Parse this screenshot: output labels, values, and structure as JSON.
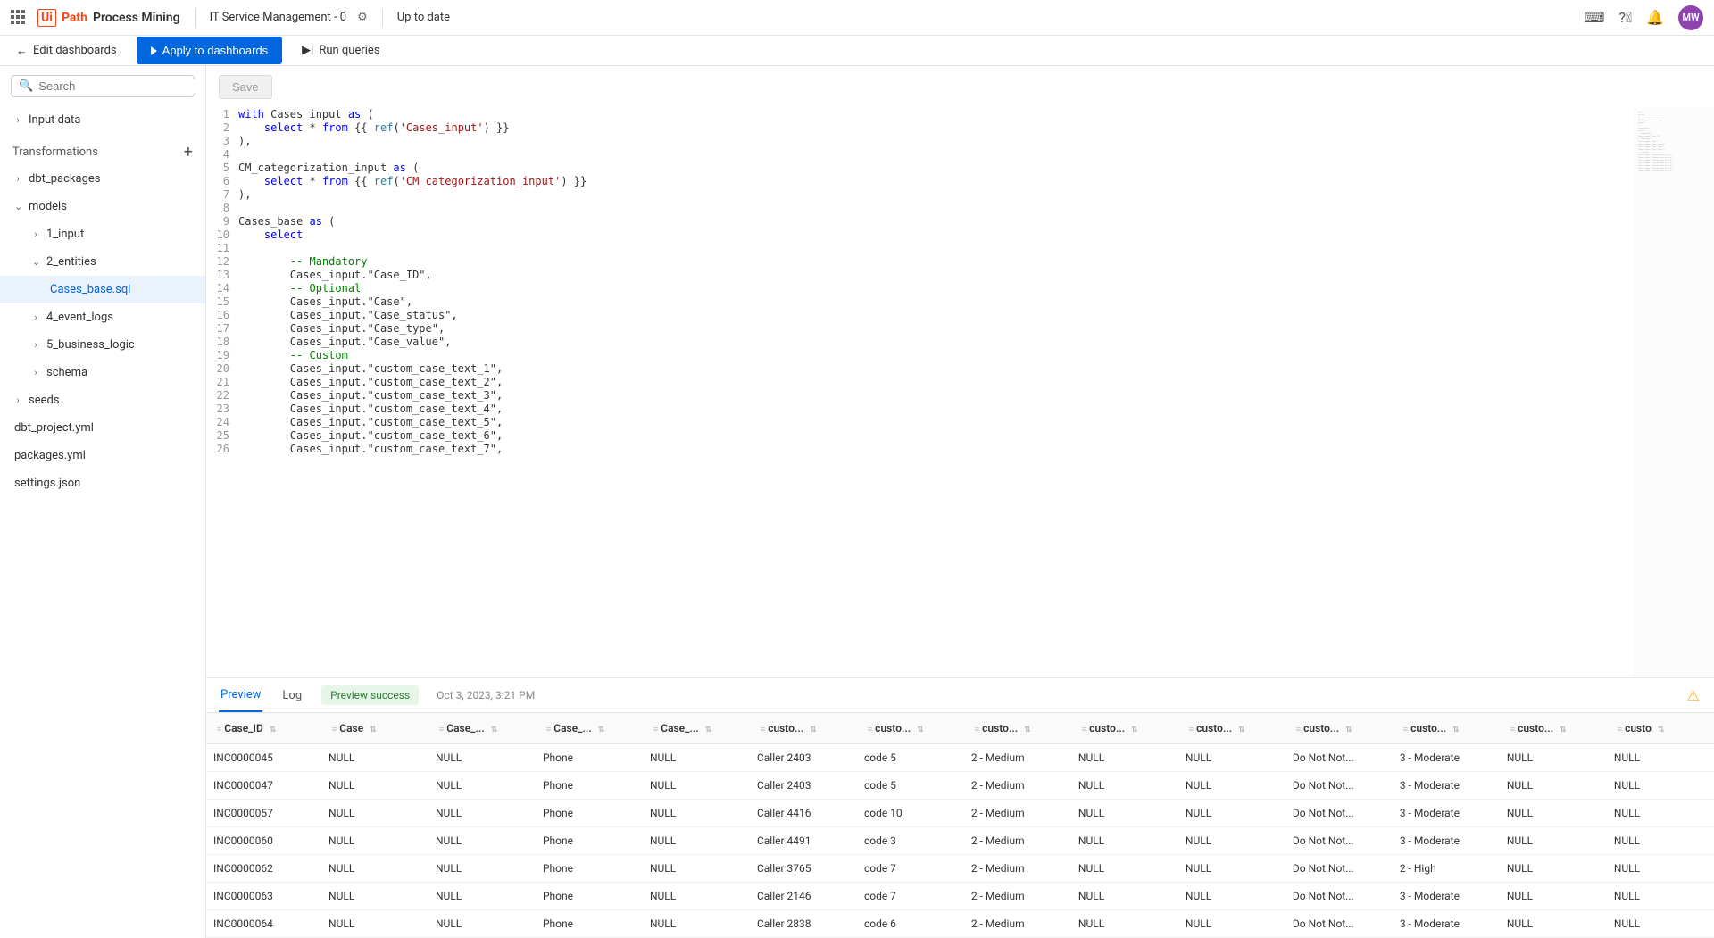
{
  "header": {
    "logo_brand": "Ui",
    "logo_path": "Path",
    "product": "Process Mining",
    "project": "IT Service Management - 0",
    "status": "Up to date",
    "avatar": "MW"
  },
  "toolbar": {
    "edit": "Edit dashboards",
    "apply": "Apply to dashboards",
    "run": "Run queries"
  },
  "sidebar": {
    "search_ph": "Search",
    "input_data": "Input data",
    "transformations": "Transformations",
    "tree": {
      "dbt_packages": "dbt_packages",
      "models": "models",
      "input1": "1_input",
      "entities2": "2_entities",
      "cases_base": "Cases_base.sql",
      "event_logs4": "4_event_logs",
      "business_logic5": "5_business_logic",
      "schema": "schema",
      "seeds": "seeds",
      "dbt_project": "dbt_project.yml",
      "packages": "packages.yml",
      "settings": "settings.json"
    }
  },
  "editor": {
    "save": "Save",
    "lines": [
      {
        "n": 1,
        "t": "with",
        "r": " Cases_input ",
        "t2": "as",
        "r2": " ("
      },
      {
        "n": 2,
        "indent": "    ",
        "t": "select",
        "r": " * ",
        "t2": "from",
        "r2": " {{ ",
        "fn": "ref",
        "r3": "(",
        "s": "'Cases_input'",
        "r4": ") }}"
      },
      {
        "n": 3,
        "plain": "),"
      },
      {
        "n": 4,
        "plain": ""
      },
      {
        "n": 5,
        "plain": "CM_categorization_input ",
        "t": "as",
        "r": " ("
      },
      {
        "n": 6,
        "indent": "    ",
        "t": "select",
        "r": " * ",
        "t2": "from",
        "r2": " {{ ",
        "fn": "ref",
        "r3": "(",
        "s": "'CM_categorization_input'",
        "r4": ") }}"
      },
      {
        "n": 7,
        "plain": "),"
      },
      {
        "n": 8,
        "plain": ""
      },
      {
        "n": 9,
        "plain": "Cases_base ",
        "t": "as",
        "r": " ("
      },
      {
        "n": 10,
        "indent": "    ",
        "t": "select"
      },
      {
        "n": 11,
        "plain": ""
      },
      {
        "n": 12,
        "indent": "        ",
        "c": "-- Mandatory"
      },
      {
        "n": 13,
        "indent": "        ",
        "plain": "Cases_input.\"Case_ID\","
      },
      {
        "n": 14,
        "indent": "        ",
        "c": "-- Optional"
      },
      {
        "n": 15,
        "indent": "        ",
        "plain": "Cases_input.\"Case\","
      },
      {
        "n": 16,
        "indent": "        ",
        "plain": "Cases_input.\"Case_status\","
      },
      {
        "n": 17,
        "indent": "        ",
        "plain": "Cases_input.\"Case_type\","
      },
      {
        "n": 18,
        "indent": "        ",
        "plain": "Cases_input.\"Case_value\","
      },
      {
        "n": 19,
        "indent": "        ",
        "c": "-- Custom"
      },
      {
        "n": 20,
        "indent": "        ",
        "plain": "Cases_input.\"custom_case_text_1\","
      },
      {
        "n": 21,
        "indent": "        ",
        "plain": "Cases_input.\"custom_case_text_2\","
      },
      {
        "n": 22,
        "indent": "        ",
        "plain": "Cases_input.\"custom_case_text_3\","
      },
      {
        "n": 23,
        "indent": "        ",
        "plain": "Cases_input.\"custom_case_text_4\","
      },
      {
        "n": 24,
        "indent": "        ",
        "plain": "Cases_input.\"custom_case_text_5\","
      },
      {
        "n": 25,
        "indent": "        ",
        "plain": "Cases_input.\"custom_case_text_6\","
      },
      {
        "n": 26,
        "indent": "        ",
        "plain": "Cases_input.\"custom_case_text_7\","
      }
    ]
  },
  "preview": {
    "tab_preview": "Preview",
    "tab_log": "Log",
    "badge": "Preview success",
    "timestamp": "Oct 3, 2023, 3:21 PM",
    "headers": [
      "Case_ID",
      "Case",
      "Case_...",
      "Case_...",
      "Case_...",
      "custo...",
      "custo...",
      "custo...",
      "custo...",
      "custo...",
      "custo...",
      "custo...",
      "custo...",
      "custo"
    ],
    "rows": [
      [
        "INC0000045",
        "NULL",
        "NULL",
        "Phone",
        "NULL",
        "Caller 2403",
        "code 5",
        "2 - Medium",
        "NULL",
        "NULL",
        "Do Not Not...",
        "3 - Moderate",
        "NULL",
        "NULL"
      ],
      [
        "INC0000047",
        "NULL",
        "NULL",
        "Phone",
        "NULL",
        "Caller 2403",
        "code 5",
        "2 - Medium",
        "NULL",
        "NULL",
        "Do Not Not...",
        "3 - Moderate",
        "NULL",
        "NULL"
      ],
      [
        "INC0000057",
        "NULL",
        "NULL",
        "Phone",
        "NULL",
        "Caller 4416",
        "code 10",
        "2 - Medium",
        "NULL",
        "NULL",
        "Do Not Not...",
        "3 - Moderate",
        "NULL",
        "NULL"
      ],
      [
        "INC0000060",
        "NULL",
        "NULL",
        "Phone",
        "NULL",
        "Caller 4491",
        "code 3",
        "2 - Medium",
        "NULL",
        "NULL",
        "Do Not Not...",
        "3 - Moderate",
        "NULL",
        "NULL"
      ],
      [
        "INC0000062",
        "NULL",
        "NULL",
        "Phone",
        "NULL",
        "Caller 3765",
        "code 7",
        "2 - Medium",
        "NULL",
        "NULL",
        "Do Not Not...",
        "2 - High",
        "NULL",
        "NULL"
      ],
      [
        "INC0000063",
        "NULL",
        "NULL",
        "Phone",
        "NULL",
        "Caller 2146",
        "code 7",
        "2 - Medium",
        "NULL",
        "NULL",
        "Do Not Not...",
        "3 - Moderate",
        "NULL",
        "NULL"
      ],
      [
        "INC0000064",
        "NULL",
        "NULL",
        "Phone",
        "NULL",
        "Caller 2838",
        "code 6",
        "2 - Medium",
        "NULL",
        "NULL",
        "Do Not Not...",
        "3 - Moderate",
        "NULL",
        "NULL"
      ]
    ]
  }
}
